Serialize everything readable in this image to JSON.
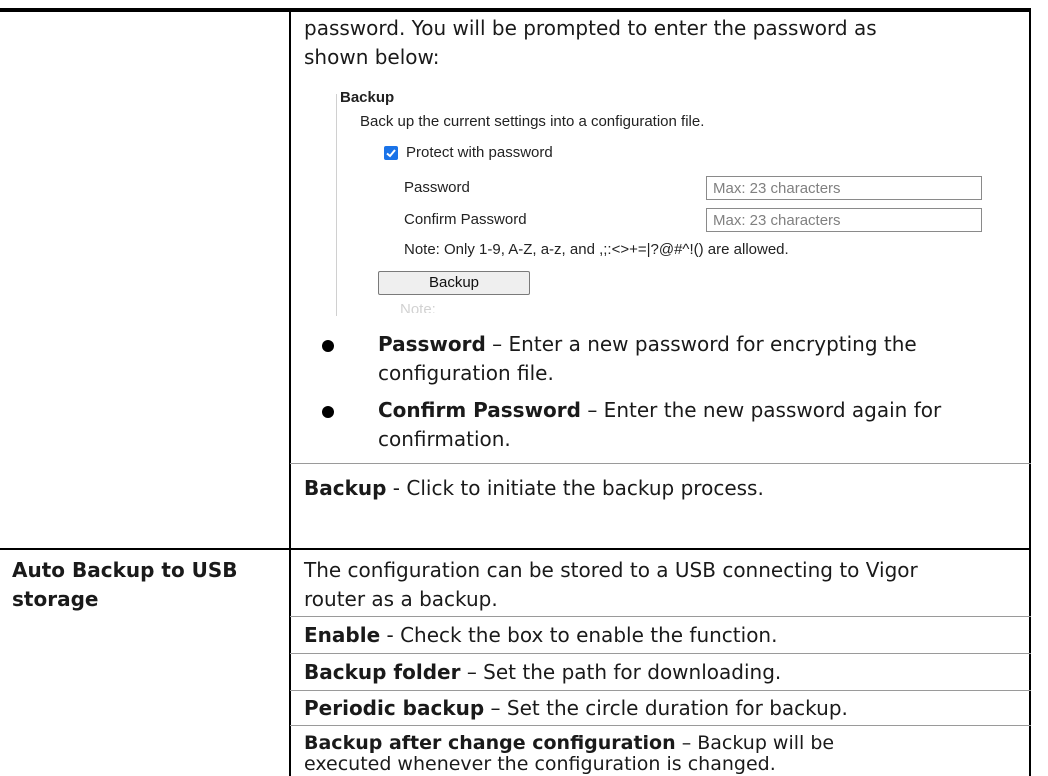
{
  "intro": {
    "line1": "password. You will be prompted to enter the password as",
    "line2": "shown below:"
  },
  "screenshot": {
    "section_title": "Backup",
    "description": "Back up the current settings into a configuration file.",
    "protect_label": "Protect with password",
    "protect_checked": true,
    "password_label": "Password",
    "password_placeholder": "Max: 23 characters",
    "confirm_label": "Confirm Password",
    "confirm_placeholder": "Max: 23 characters",
    "note": "Note: Only 1-9, A-Z, a-z, and ,;:<>+=|?@#^!() are allowed.",
    "backup_button": "Backup",
    "faded_note": "Note:"
  },
  "bullets": [
    {
      "term": "Password",
      "line1": " – Enter a new password for encrypting the",
      "line2": "configuration file."
    },
    {
      "term": "Confirm Password",
      "line1": " – Enter the new password again for",
      "line2": "confirmation."
    }
  ],
  "backup_row": {
    "term": "Backup",
    "desc": " - Click to initiate the backup process."
  },
  "auto_backup": {
    "label_line1": "Auto Backup to USB",
    "label_line2": "storage",
    "intro_line1": "The configuration can be stored to a USB connecting to Vigor",
    "intro_line2": "router as a backup.",
    "enable_term": "Enable",
    "enable_desc": " - Check the box to enable the function.",
    "folder_term": "Backup folder",
    "folder_desc": " – Set the path for downloading.",
    "periodic_term": "Periodic backup",
    "periodic_desc": " – Set the circle duration for backup.",
    "after_term": "Backup after change configuration",
    "after_desc_line1": " – Backup will be",
    "after_desc_line2": "executed whenever the configuration is changed."
  }
}
